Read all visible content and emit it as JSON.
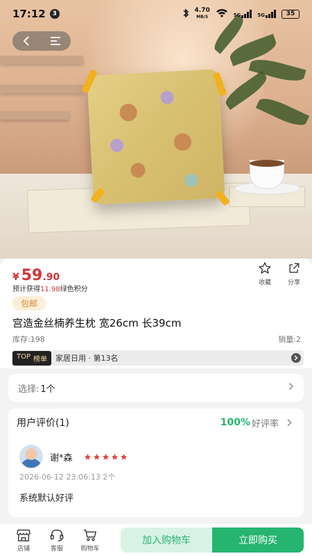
{
  "status_bar": {
    "time": "17:12",
    "notification_count": "3",
    "net_speed_value": "4.70",
    "net_speed_unit": "MB/S",
    "signal1_label": "5G",
    "signal2_label": "5G",
    "battery": "35"
  },
  "product": {
    "price_currency": "¥",
    "price_integer": "59",
    "price_decimal": ".90",
    "points_prefix": "预计获得",
    "points_value": "11.98",
    "points_suffix": "绿色积分",
    "favorite_label": "收藏",
    "share_label": "分享",
    "shipping_tag": "包邮",
    "title": "宫造金丝楠养生枕 宽26cm 长39cm",
    "stock": "库存:198",
    "sales": "销量:2",
    "rank_tag_top": "TOP",
    "rank_tag_label": "榜单",
    "rank_text": "家居日用 · 第13名"
  },
  "selection": {
    "label": "选择:",
    "value": "1个"
  },
  "reviews": {
    "title": "用户评价(1)",
    "rate_value": "100%",
    "rate_label": "好评率",
    "items": [
      {
        "name": "谢*森",
        "stars": 5,
        "time": "2026-06-12 23:06:13 2个",
        "content": "系统默认好评"
      }
    ]
  },
  "bottom_bar": {
    "shop_label": "店铺",
    "service_label": "客服",
    "cart_label": "购物车",
    "add_to_cart": "加入购物车",
    "buy_now": "立即购买"
  },
  "colors": {
    "accent_green": "#25b570",
    "price_red": "#d2343a",
    "star_red": "#e0403a"
  }
}
